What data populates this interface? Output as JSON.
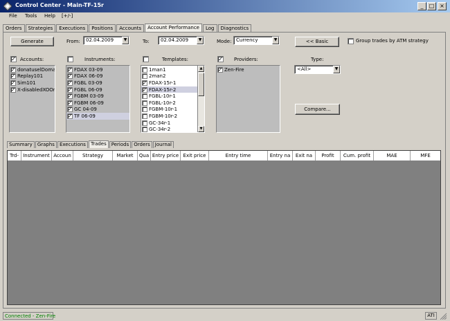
{
  "window": {
    "title": "Control Center - Main-TF-15r",
    "minimize": "_",
    "maximize": "□",
    "close": "×"
  },
  "menu": [
    "File",
    "Tools",
    "Help",
    "[+/-]"
  ],
  "tabs": [
    "Orders",
    "Strategies",
    "Executions",
    "Positions",
    "Accounts",
    "Account Performance",
    "Log",
    "Diagnostics"
  ],
  "active_tab": "Account Performance",
  "controls": {
    "generate_label": "Generate",
    "from_label": "From:",
    "from_value": "02.04.2009",
    "to_label": "To:",
    "to_value": "02.04.2009",
    "mode_label": "Mode:",
    "mode_value": "Currency",
    "basic_label": "<< Basic",
    "group_trades_label": "Group trades by ATM strategy",
    "type_label": "Type:",
    "type_value": "<All>",
    "compare_label": "Compare..."
  },
  "accounts": {
    "header": "Accounts:",
    "items": [
      "donatuselDomar",
      "Replay101",
      "Sim101",
      "X-disabledXOOn"
    ]
  },
  "instruments": {
    "header": "Instruments:",
    "items": [
      "FDAX 03-09",
      "FDAX 06-09",
      "FGBL 03-09",
      "FGBL 06-09",
      "FGBM 03-09",
      "FGBM 06-09",
      "GC 04-09",
      "TF 06-09"
    ]
  },
  "templates": {
    "header": "Templates:",
    "items": [
      {
        "label": "1man1",
        "checked": false
      },
      {
        "label": "2man2",
        "checked": false
      },
      {
        "label": "FDAX-15r-1",
        "checked": true
      },
      {
        "label": "FDAX-15r-2",
        "checked": true
      },
      {
        "label": "FGBL-10r-1",
        "checked": false
      },
      {
        "label": "FGBL-10r-2",
        "checked": false
      },
      {
        "label": "FGBM-10r-1",
        "checked": false
      },
      {
        "label": "FGBM-10r-2",
        "checked": false
      },
      {
        "label": "GC-34r-1",
        "checked": false
      },
      {
        "label": "GC-34r-2",
        "checked": false
      }
    ]
  },
  "providers": {
    "header": "Providers:",
    "items": [
      "Zen-Fire"
    ]
  },
  "subtabs": [
    "Summary",
    "Graphs",
    "Executions",
    "Trades",
    "Periods",
    "Orders",
    "Journal"
  ],
  "active_subtab": "Trades",
  "columns": [
    "Trd-",
    "Instrument",
    "Accoun",
    "Strategy",
    "Market",
    "Qua",
    "Entry price",
    "Exit price",
    "Entry time",
    "Entry na",
    "Exit na",
    "Profit",
    "Cum. profit",
    "MAE",
    "MFE"
  ],
  "status": {
    "connection": "Connected - Zen-Fire",
    "right": "ATI"
  },
  "colors": {
    "title_start": "#0a246a",
    "title_end": "#a6caf0",
    "grid_bg": "#808080",
    "status_green": "#00ff00"
  }
}
